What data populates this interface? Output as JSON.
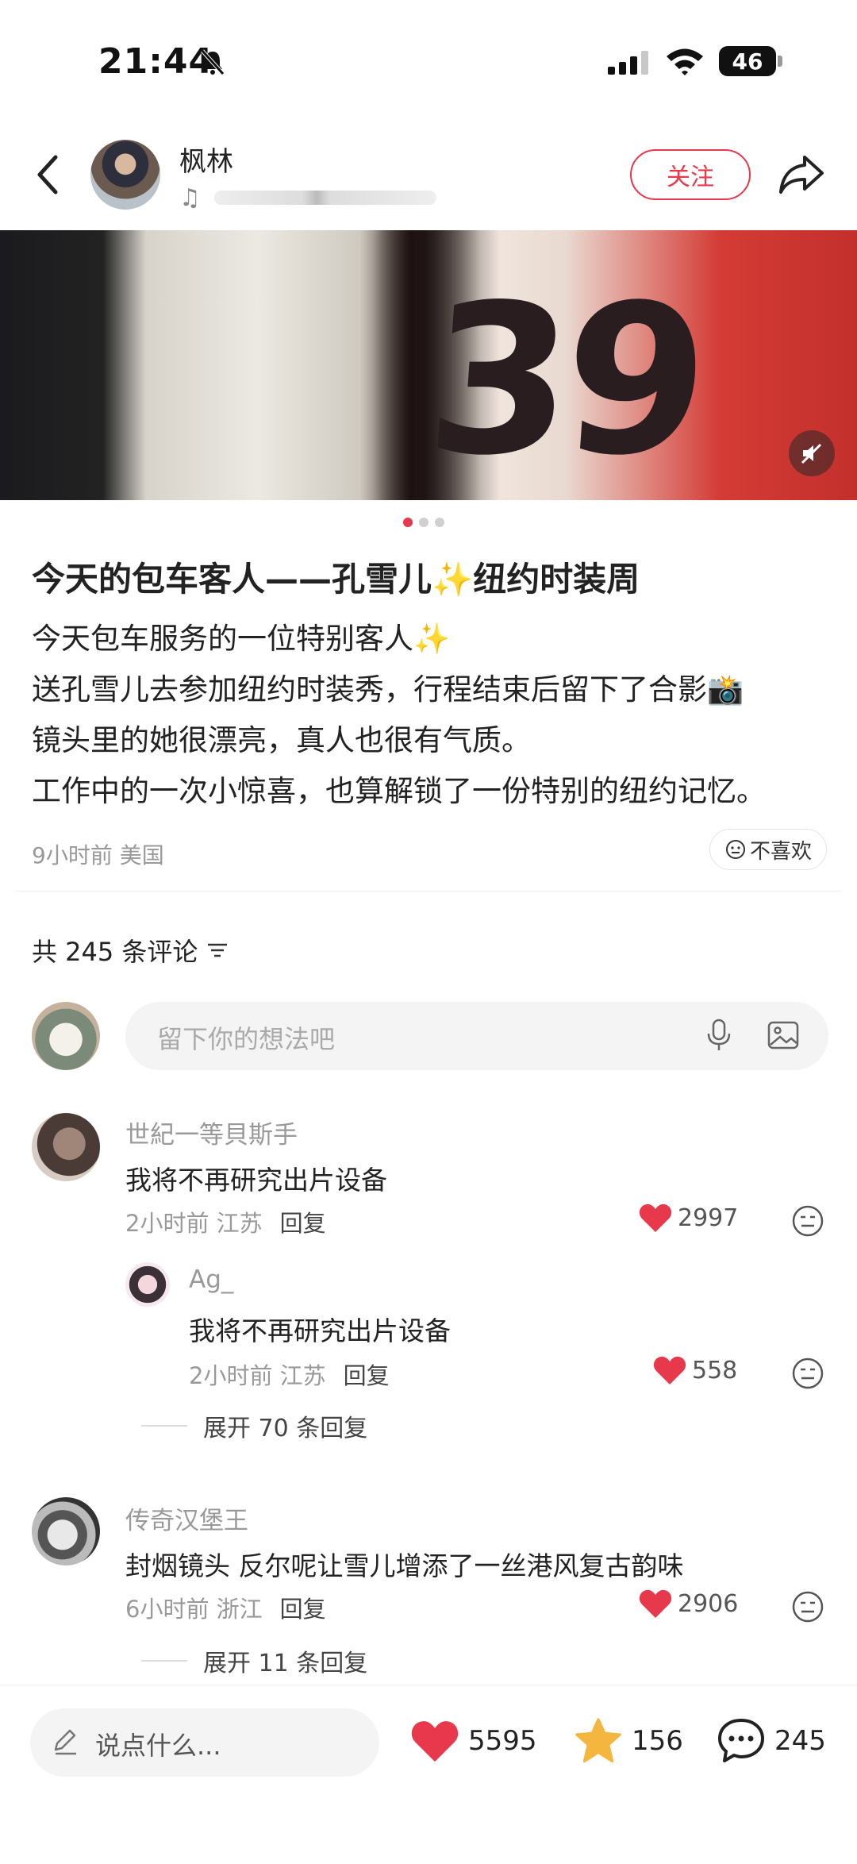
{
  "status_bar": {
    "time": "21:44",
    "battery": "46"
  },
  "author": {
    "name": "枫林"
  },
  "header": {
    "follow_label": "关注"
  },
  "carousel": {
    "jersey_text": "39",
    "dots_count": 3,
    "active_index": 0
  },
  "post": {
    "title": "今天的包车客人——孔雪儿✨纽约时装周",
    "body": [
      "今天包车服务的一位特别客人✨",
      "送孔雪儿去参加纽约时装秀，行程结束后留下了合影📸",
      "镜头里的她很漂亮，真人也很有气质。",
      "工作中的一次小惊喜，也算解锁了一份特别的纽约记忆。"
    ],
    "meta": "9小时前 美国",
    "dislike_label": "不喜欢"
  },
  "comments_section": {
    "count_label": "共 245 条评论",
    "input_placeholder": "留下你的想法吧"
  },
  "comments": [
    {
      "user": "世紀一等貝斯手",
      "text": "我将不再研究出片设备",
      "meta": "2小时前 江苏",
      "reply_label": "回复",
      "likes": "2997",
      "replies": [
        {
          "user": "Ag_",
          "text": "我将不再研究出片设备",
          "meta": "2小时前 江苏",
          "reply_label": "回复",
          "likes": "558"
        }
      ],
      "expand_label": "展开 70 条回复"
    },
    {
      "user": "传奇汉堡王",
      "text": "封烟镜头 反尔呢让雪儿增添了一丝港风复古韵味",
      "meta": "6小时前 浙江",
      "reply_label": "回复",
      "likes": "2906",
      "expand_label": "展开 11 条回复"
    }
  ],
  "bottom_bar": {
    "say_placeholder": "说点什么...",
    "likes": "5595",
    "stars": "156",
    "comments": "245"
  },
  "colors": {
    "accent": "#e8384b",
    "star": "#f4b63f"
  }
}
